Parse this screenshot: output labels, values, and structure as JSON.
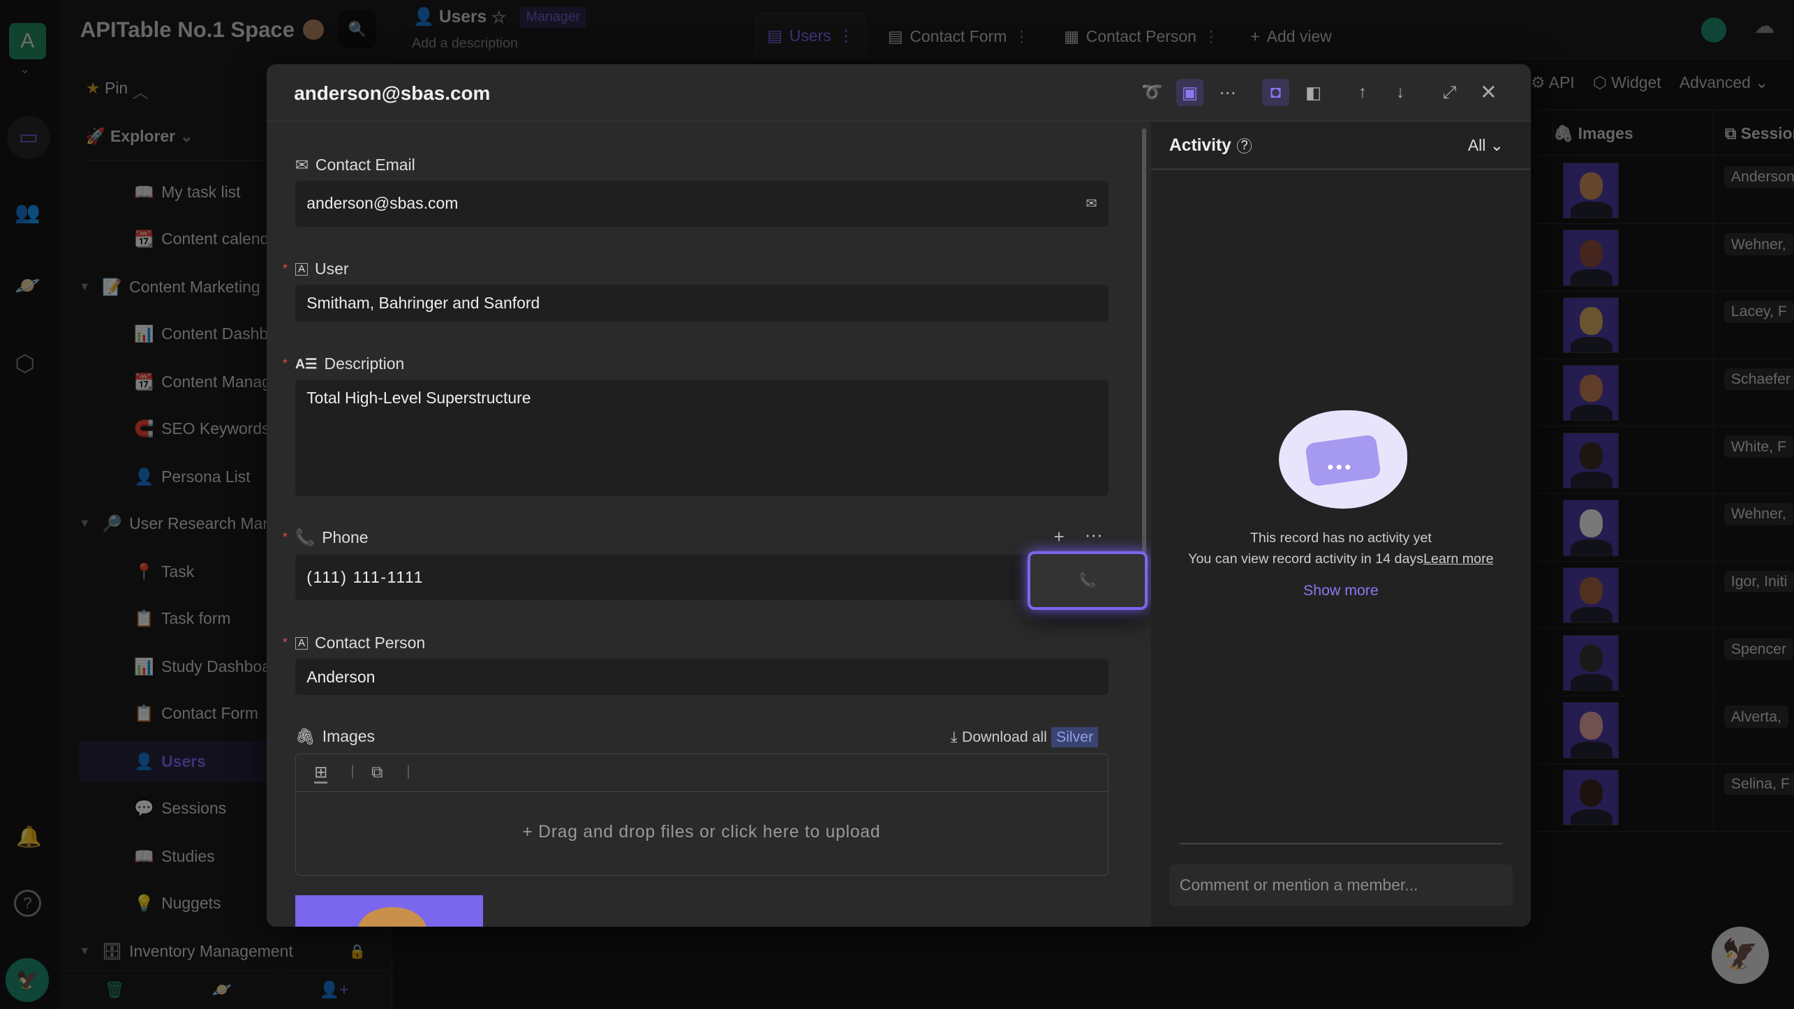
{
  "space": {
    "avatar_letter": "A",
    "name": "APITable No.1 Space"
  },
  "sidebar": {
    "pin": "Pin",
    "explorer": "Explorer",
    "items": [
      {
        "label": "My task list",
        "icon": "📖",
        "level": 2
      },
      {
        "label": "Content calendar",
        "icon": "📆",
        "level": 2
      },
      {
        "label": "Content Marketing",
        "icon": "📝",
        "level": 1,
        "folder": true
      },
      {
        "label": "Content Dashboard",
        "icon": "📊",
        "level": 2
      },
      {
        "label": "Content Management",
        "icon": "📆",
        "level": 2
      },
      {
        "label": "SEO Keywords",
        "icon": "🧲",
        "level": 2
      },
      {
        "label": "Persona List",
        "icon": "👤",
        "level": 2
      },
      {
        "label": "User Research Management",
        "icon": "🔎",
        "level": 1,
        "folder": true
      },
      {
        "label": "Task",
        "icon": "📍",
        "level": 2
      },
      {
        "label": "Task form",
        "icon": "📋",
        "level": 2
      },
      {
        "label": "Study Dashboard",
        "icon": "📊",
        "level": 2
      },
      {
        "label": "Contact Form",
        "icon": "📋",
        "level": 2
      },
      {
        "label": "Users",
        "icon": "👤",
        "level": 2,
        "active": true
      },
      {
        "label": "Sessions",
        "icon": "💬",
        "level": 2
      },
      {
        "label": "Studies",
        "icon": "📖",
        "level": 2
      },
      {
        "label": "Nuggets",
        "icon": "💡",
        "level": 2
      },
      {
        "label": "Inventory Management",
        "icon": "🗄",
        "level": 1,
        "folder": true,
        "locked": true
      }
    ]
  },
  "datasheet": {
    "title": "Users",
    "role": "Manager",
    "description_placeholder": "Add a description",
    "tabs": [
      "Users",
      "Contact Form",
      "Contact Person"
    ],
    "add_view": "Add view",
    "toolbar": {
      "api": "API",
      "widget": "Widget",
      "advanced": "Advanced"
    },
    "columns": {
      "images": "Images",
      "sessions": "Sessions"
    },
    "session_cells": [
      "Anderson",
      "Wehner,",
      "Lacey, F",
      "Schaefer",
      "White, F",
      "Wehner,",
      "Igor, Initi",
      "Spencer",
      "Alverta,",
      "Selina, F"
    ]
  },
  "record": {
    "title": "anderson@sbas.com",
    "fields": {
      "email": {
        "label": "Contact Email",
        "value": "anderson@sbas.com"
      },
      "user": {
        "label": "User",
        "value": "Smitham, Bahringer and Sanford"
      },
      "description": {
        "label": "Description",
        "value": "Total High-Level Superstructure"
      },
      "phone": {
        "label": "Phone",
        "value": "(111) 111-1111"
      },
      "contact_person": {
        "label": "Contact Person",
        "value": "Anderson"
      },
      "images": {
        "label": "Images",
        "download_all": "Download all",
        "plan_badge": "Silver",
        "upload_hint": "+ Drag and drop files or click here to upload"
      }
    }
  },
  "activity": {
    "title": "Activity",
    "filter": "All",
    "empty_line1": "This record has no activity yet",
    "empty_line2": "You can view record activity in 14 days",
    "learn_more": "Learn more",
    "show_more": "Show more",
    "comment_placeholder": "Comment or mention a member..."
  },
  "colors": {
    "accent": "#7b67ee",
    "required": "#e5484d",
    "badge_bg": "#3a4370"
  }
}
